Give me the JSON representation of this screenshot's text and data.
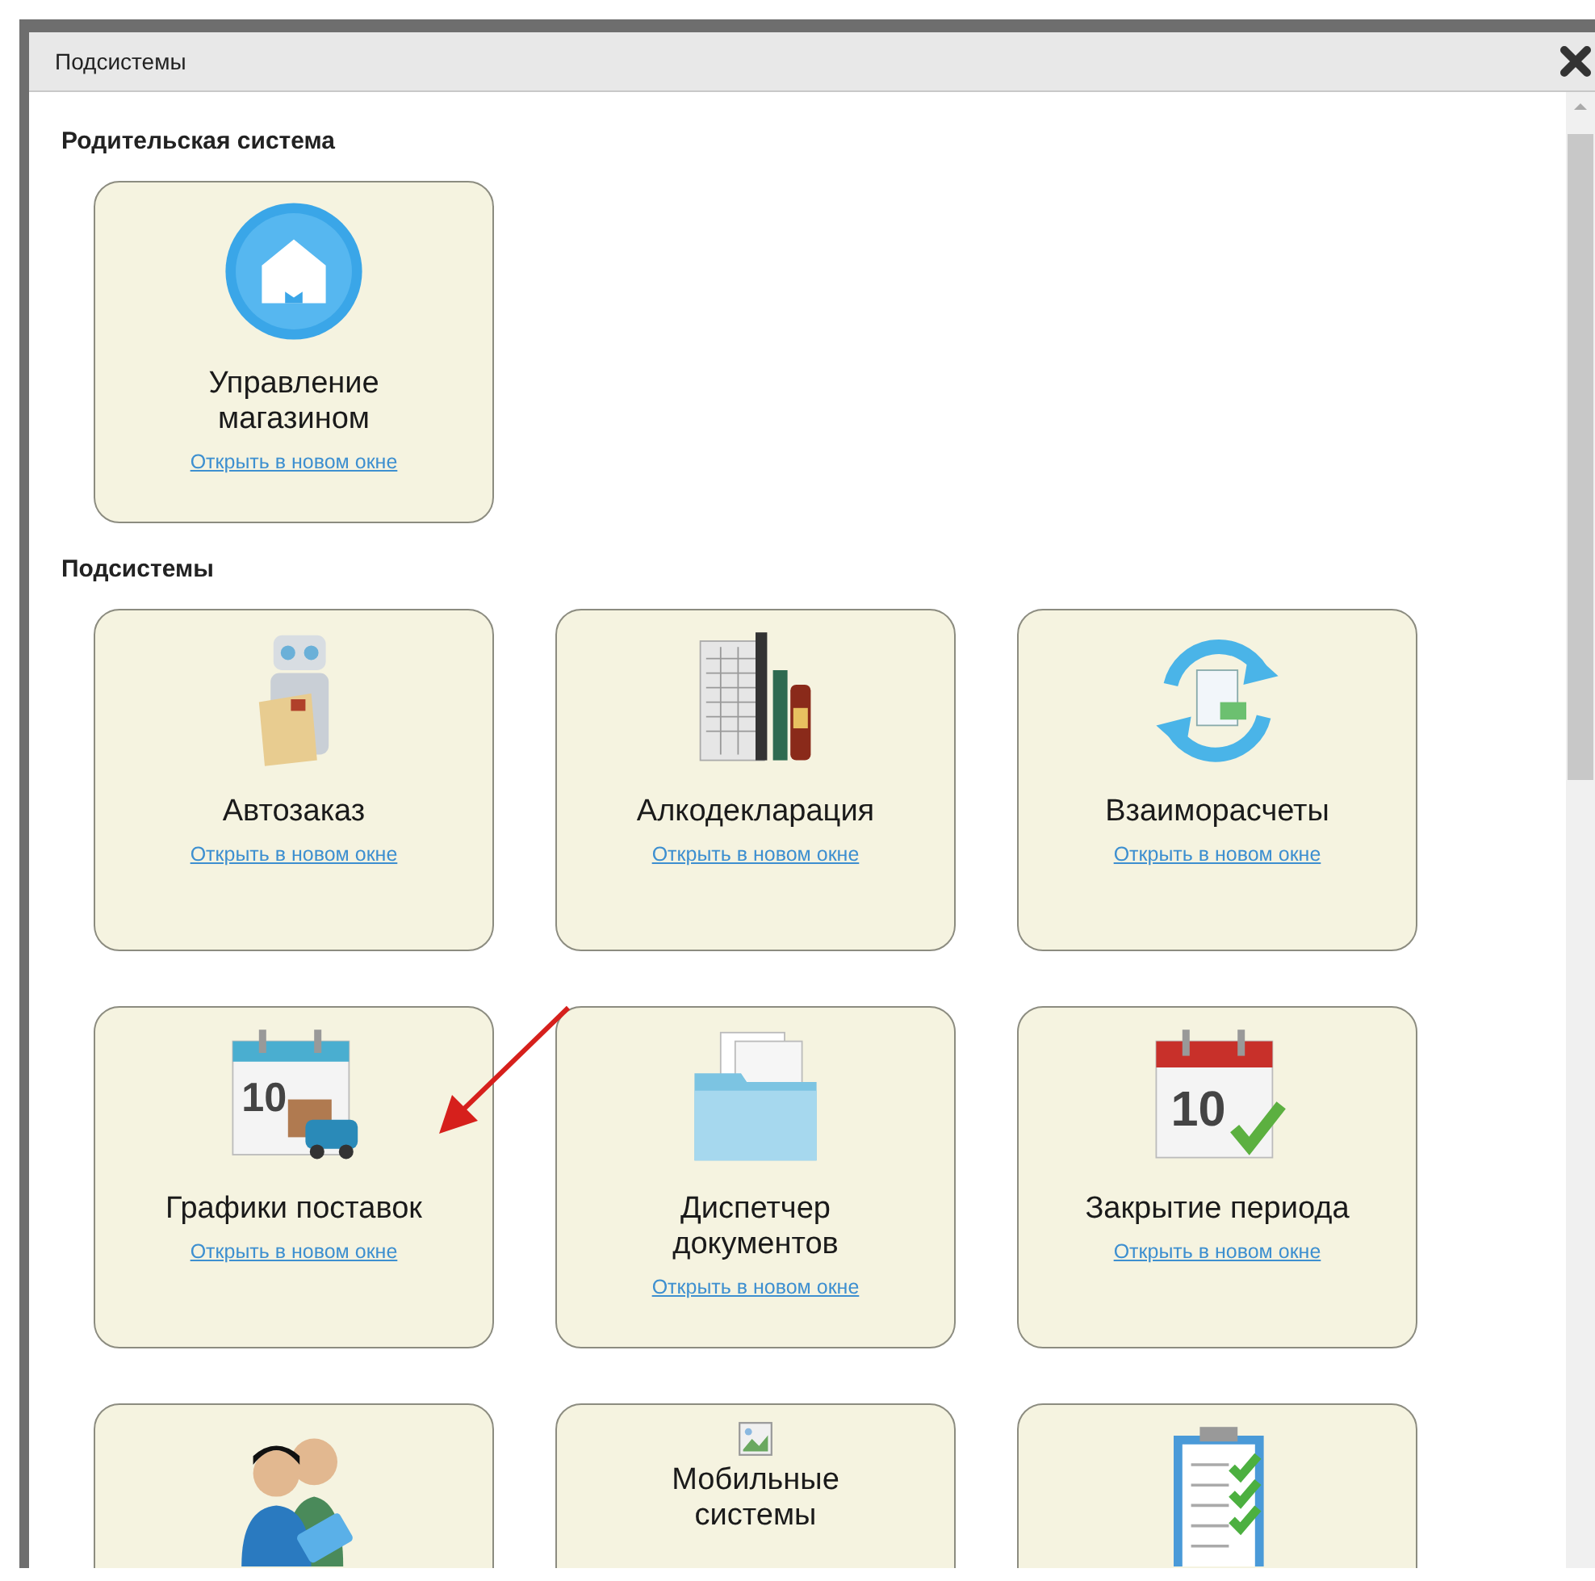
{
  "window": {
    "title": "Подсистемы"
  },
  "sections": [
    {
      "heading": "Родительская система",
      "cards": [
        {
          "kind": "subsystem",
          "name": "Управление\nмагазином",
          "link": "Открыть в новом окне"
        }
      ]
    },
    {
      "heading": "Подсистемы",
      "cards": [
        {
          "kind": "subsystem",
          "name": "Автозаказ",
          "link": "Открыть в новом окне"
        },
        {
          "kind": "subsystem",
          "name": "Алкодекларация",
          "link": "Открыть в новом окне"
        },
        {
          "kind": "subsystem",
          "name": "Взаиморасчеты",
          "link": "Открыть в новом окне"
        },
        {
          "kind": "subsystem",
          "name": "Графики поставок",
          "icon_text": "10",
          "link": "Открыть в новом окне"
        },
        {
          "kind": "subsystem",
          "name": "Диспетчер\nдокументов",
          "link": "Открыть в новом окне"
        },
        {
          "kind": "subsystem",
          "name": "Закрытие периода",
          "icon_text": "10",
          "link": "Открыть в новом окне"
        },
        {
          "kind": "subsystem"
        },
        {
          "kind": "subsystem",
          "name": "Мобильные\nсистемы"
        },
        {
          "kind": "subsystem"
        }
      ]
    }
  ]
}
